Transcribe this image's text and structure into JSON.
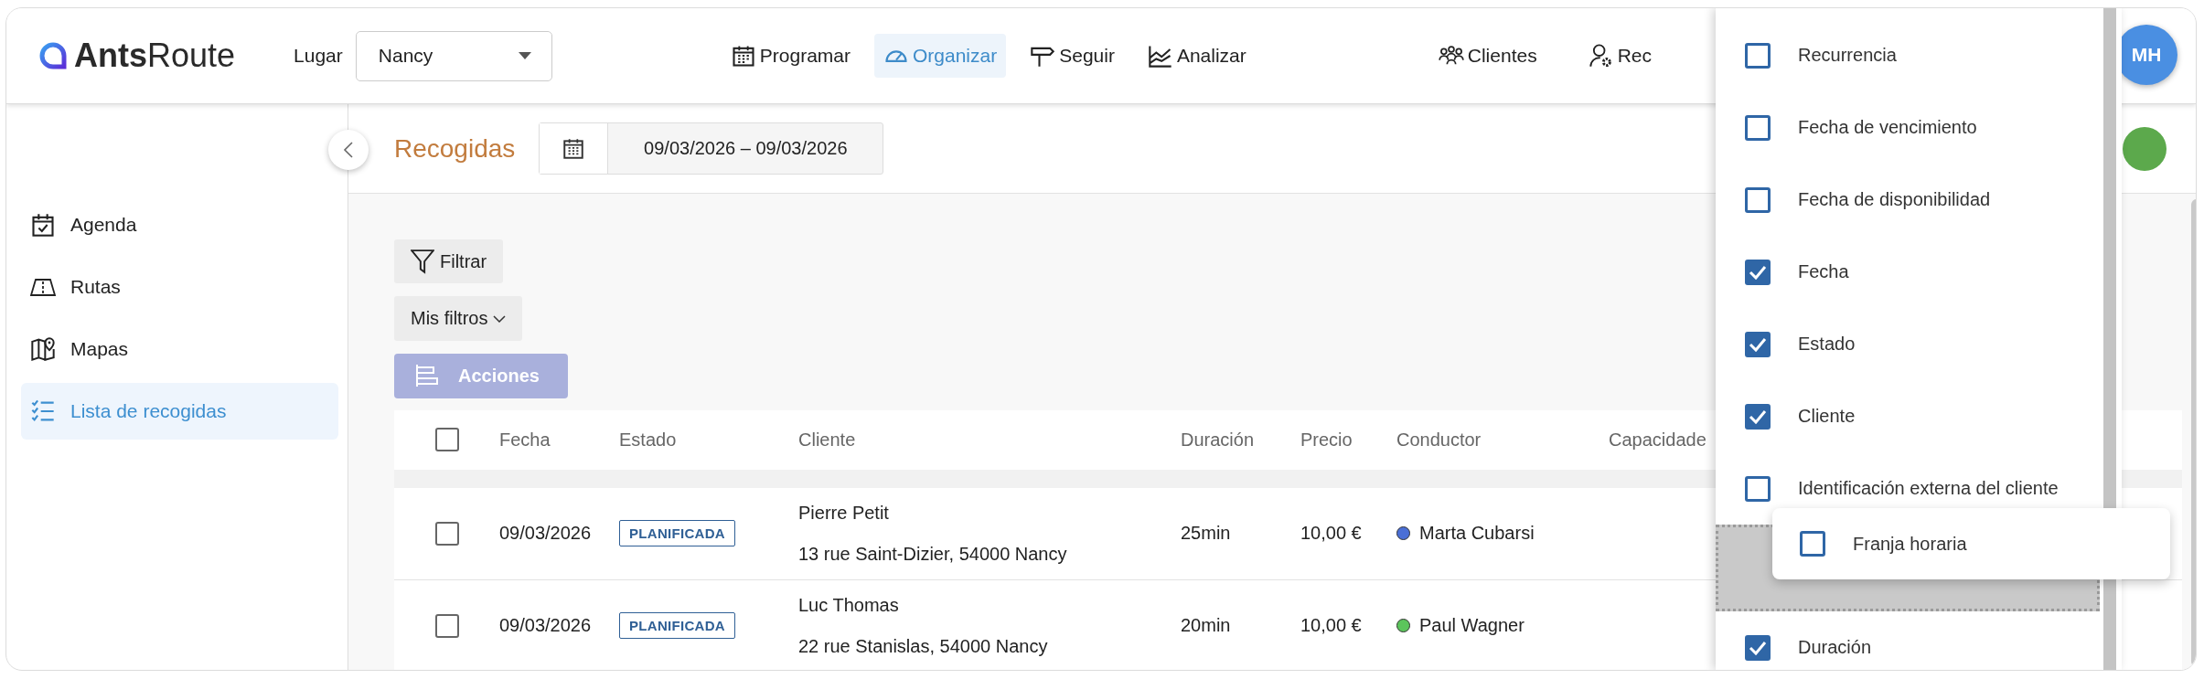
{
  "topbar": {
    "logo": "**Ants**Route",
    "place_label": "Lugar",
    "place_select": {
      "value": "Nancy"
    },
    "nav": [
      {
        "label": "Programar",
        "selected": false
      },
      {
        "label": "Organizar",
        "selected": true
      },
      {
        "label": "Seguir",
        "selected": false
      },
      {
        "label": "Analizar",
        "selected": false
      }
    ],
    "nav_right": [
      {
        "label": "Clientes"
      },
      {
        "label": "Rec"
      }
    ],
    "avatar": "MH"
  },
  "sidebar": {
    "items": [
      {
        "label": "Agenda",
        "selected": false
      },
      {
        "label": "Rutas",
        "selected": false
      },
      {
        "label": "Mapas",
        "selected": false
      },
      {
        "label": "Lista de recogidas",
        "selected": true
      }
    ]
  },
  "page": {
    "title": "Recogidas",
    "date_range": "09/03/2026 – 09/03/2026"
  },
  "toolbar": {
    "filter": "Filtrar",
    "my_filters": "Mis filtros",
    "actions": {
      "label": "Acciones",
      "disabled": true
    }
  },
  "table": {
    "select_all": {
      "checked": false
    },
    "columns": [
      "Fecha",
      "Estado",
      "Cliente",
      "Duración",
      "Precio",
      "Conductor",
      "Capacidade"
    ],
    "rows": [
      {
        "checked": false,
        "date": "09/03/2026",
        "status": "PLANIFICADA",
        "client": "Pierre Petit",
        "address": "13 rue Saint-Dizier, 54000 Nancy",
        "duration": "25min",
        "price": "10,00 €",
        "driver": "Marta Cubarsi",
        "color": "#4a6fd6"
      },
      {
        "checked": false,
        "date": "09/03/2026",
        "status": "PLANIFICADA",
        "client": "Luc Thomas",
        "address": "22 rue Stanislas, 54000 Nancy",
        "duration": "20min",
        "price": "10,00 €",
        "driver": "Paul Wagner",
        "color": "#5cc55c"
      }
    ]
  },
  "columns_menu": {
    "items": [
      {
        "kind": "option",
        "label": "Recurrencia",
        "checked": false
      },
      {
        "kind": "option",
        "label": "Fecha de vencimiento",
        "checked": false
      },
      {
        "kind": "option",
        "label": "Fecha de disponibilidad",
        "checked": false
      },
      {
        "kind": "option",
        "label": "Fecha",
        "checked": true
      },
      {
        "kind": "option",
        "label": "Estado",
        "checked": true
      },
      {
        "kind": "option",
        "label": "Cliente",
        "checked": true
      },
      {
        "kind": "option",
        "label": "Identificación externa del cliente",
        "checked": false
      },
      {
        "kind": "drop_slot"
      },
      {
        "kind": "option",
        "label": "Duración",
        "checked": true
      }
    ],
    "dragging": {
      "label": "Franja horaria",
      "checked": false
    }
  }
}
